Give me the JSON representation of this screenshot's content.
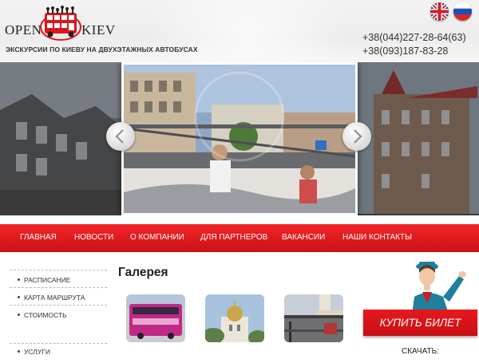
{
  "header": {
    "logo": {
      "word_left": "OPEN",
      "word_right": "KIEV"
    },
    "tagline": "ЭКСКУРСИИ ПО КИЕВУ НА ДВУХЭТАЖНЫХ АВТОБУСАХ",
    "phones": [
      "+38(044)227-28-64(63)",
      "+38(093)187-83-28"
    ],
    "languages": [
      {
        "code": "en",
        "icon": "uk-flag-icon"
      },
      {
        "code": "ru",
        "icon": "ru-flag-icon"
      }
    ]
  },
  "slider": {
    "prev_icon": "chevron-left-icon",
    "next_icon": "chevron-right-icon"
  },
  "nav": {
    "items": [
      "ГЛАВНАЯ",
      "НОВОСТИ",
      "О КОМПАНИИ",
      "ДЛЯ ПАРТНЕРОВ",
      "ВАКАНСИИ",
      "НАШИ КОНТАКТЫ"
    ]
  },
  "sidebar": {
    "items": [
      "РАСПИСАНИЕ",
      "КАРТА МАРШРУТА",
      "СТОИМОСТЬ",
      "УСЛУГИ"
    ]
  },
  "gallery": {
    "title": "Галерея"
  },
  "aside": {
    "buy_button": "КУПИТЬ БИЛЕТ",
    "download_label": "СКАЧАТЬ:"
  },
  "colors": {
    "accent_red": "#dd1a1e",
    "text_dark": "#333333"
  }
}
